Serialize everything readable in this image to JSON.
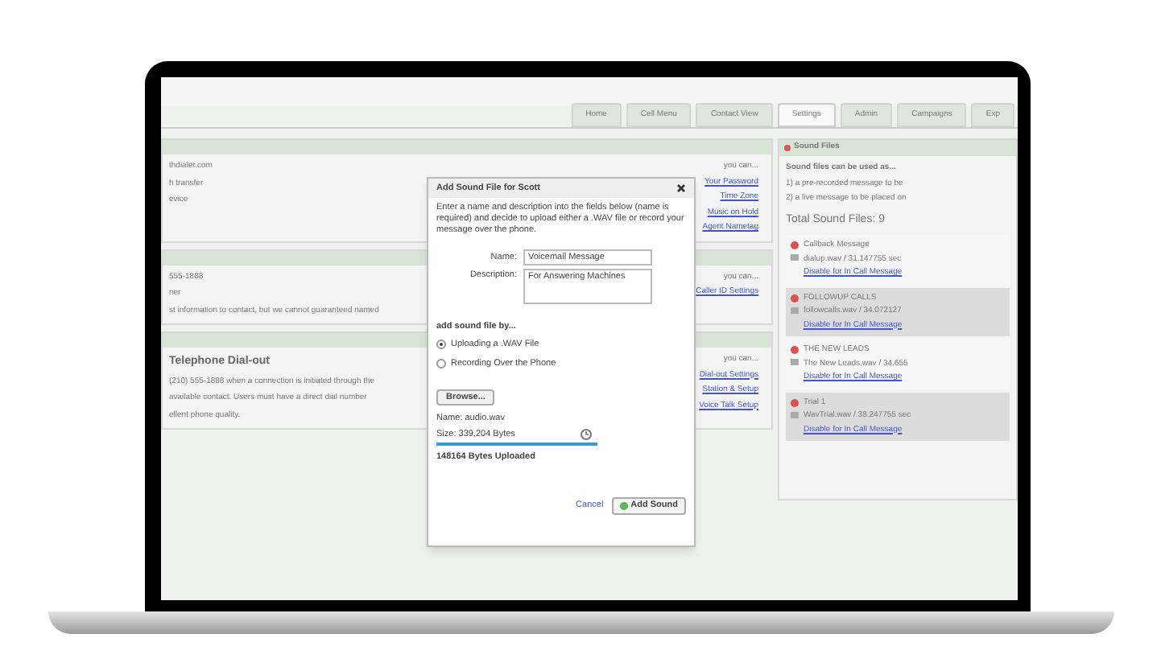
{
  "nav_tabs": [
    {
      "label": "Home",
      "selected": false
    },
    {
      "label": "Cell Menu",
      "selected": false
    },
    {
      "label": "Contact View",
      "selected": false
    },
    {
      "label": "Settings",
      "selected": true
    },
    {
      "label": "Admin",
      "selected": false
    },
    {
      "label": "Campaigns",
      "selected": false
    },
    {
      "label": "Exp",
      "selected": false
    }
  ],
  "left_sections": [
    {
      "lines": [
        "thdialer.com",
        "h transfer",
        "evice"
      ],
      "links_heading": "you can...",
      "links": [
        "Your Password",
        "Time Zone",
        "Music on Hold",
        "Agent Nametag"
      ]
    },
    {
      "lines": [
        "555-1888",
        "ner",
        "st information to contact, but we cannot guaranteed named"
      ],
      "links_heading": "you can...",
      "links": [
        "Caller ID Settings"
      ]
    },
    {
      "heading": "Telephone Dial-out",
      "lines": [
        "(210) 555-1888 when a connection is initiated through the",
        "available contact. Users must have a direct dial number",
        "ellent phone quality."
      ],
      "links_heading": "you can...",
      "links": [
        "Dial-out Settings",
        "Station & Setup",
        "Voice Talk Setup"
      ]
    }
  ],
  "dialog": {
    "title": "Add Sound File for Scott",
    "intro": "Enter a name and description into the fields below (name is required) and decide to upload either a .WAV file or record your message over the phone.",
    "name_label": "Name:",
    "name_value": "Voicemail Message",
    "description_label": "Description:",
    "description_value": "For Answering Machines",
    "method_heading": "add sound file by...",
    "methods": [
      {
        "label": "Uploading a .WAV File",
        "selected": true
      },
      {
        "label": "Recording Over the Phone",
        "selected": false
      }
    ],
    "browse": "Browse...",
    "file_name": "Name: audio.wav",
    "file_size": "Size: 339,204 Bytes",
    "level": 1,
    "uploaded": "148164 Bytes Uploaded",
    "cancel": "Cancel",
    "submit": "Add Sound"
  },
  "sound_panel": {
    "title": "Sound Files",
    "intro": "Sound files can be used as...",
    "uses": [
      "1) a pre-recorded message to be",
      "2) a live message to be placed on"
    ],
    "total": "Total Sound Files: 9",
    "files": [
      {
        "name": "Callback Message",
        "detail": "dialup.wav / 31.147755 sec",
        "link": "Disable for In Call Message",
        "selected": false
      },
      {
        "name": "FOLLOWUP CALLS",
        "detail": "followcalls.wav / 34.072127",
        "link": "Disable for In Call Message",
        "selected": true
      },
      {
        "name": "THE NEW LEADS",
        "detail": "The New Leads.wav / 34.655",
        "link": "Disable for In Call Message",
        "selected": false
      },
      {
        "name": "Trial 1",
        "detail": "WavTrial.wav / 38.247755 sec",
        "link": "Disable for In Call Message",
        "selected": true
      }
    ]
  }
}
